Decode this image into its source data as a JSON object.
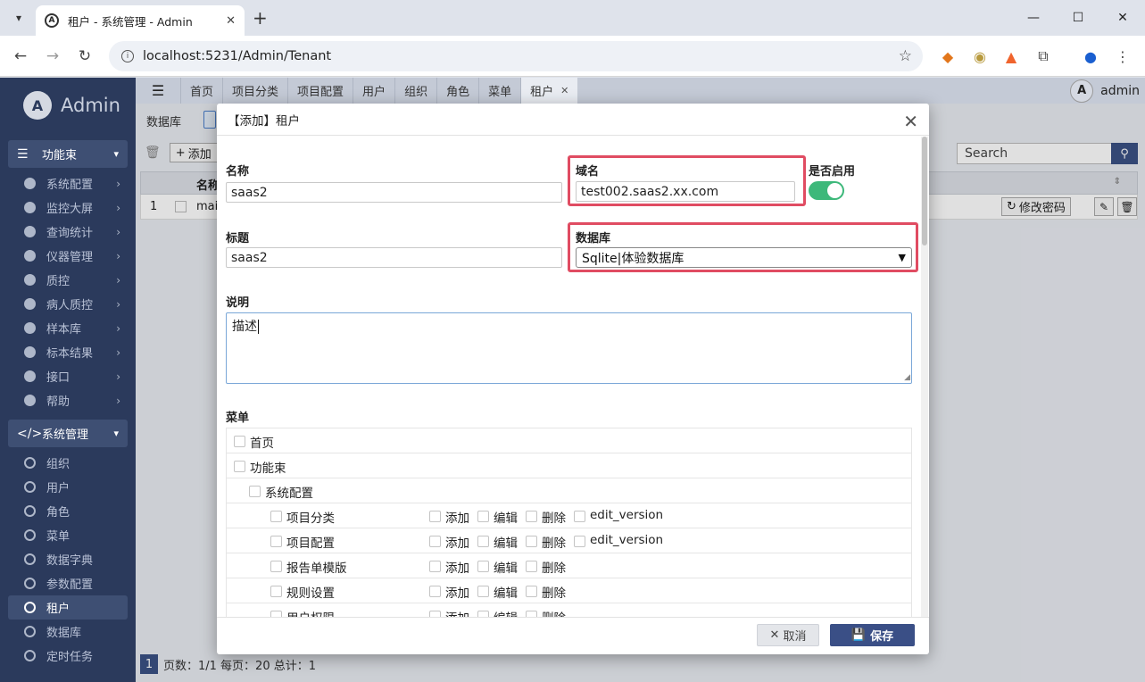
{
  "browser": {
    "tab_title": "租户 - 系统管理 - Admin",
    "favicon_letter": "A",
    "url": "localhost:5231/Admin/Tenant"
  },
  "sidebar": {
    "logo_letter": "A",
    "logo_text": "Admin",
    "group1": {
      "label": "功能束",
      "items": [
        "系统配置",
        "监控大屏",
        "查询统计",
        "仪器管理",
        "质控",
        "病人质控",
        "样本库",
        "标本结果",
        "接口",
        "帮助"
      ]
    },
    "group2": {
      "label": "系统管理",
      "items": [
        "组织",
        "用户",
        "角色",
        "菜单",
        "数据字典",
        "参数配置",
        "租户",
        "数据库",
        "定时任务"
      ],
      "active_index": 6
    }
  },
  "apptabs": {
    "tabs": [
      "首页",
      "项目分类",
      "项目配置",
      "用户",
      "组织",
      "角色",
      "菜单",
      "租户"
    ],
    "active_index": 7,
    "user_letter": "A",
    "user_name": "admin"
  },
  "background": {
    "db_label": "数据库",
    "add_label": "添加",
    "search_placeholder": "Search",
    "col_name": "名称",
    "row_num": "1",
    "row_name": "mai",
    "change_pwd": "修改密码",
    "pager_page": "1",
    "pager_text": "页数：1/1 每页：20 总计：1"
  },
  "dialog": {
    "title": "【添加】租户",
    "name_label": "名称",
    "name_value": "saas2",
    "domain_label": "域名",
    "domain_value": "test002.saas2.xx.com",
    "enabled_label": "是否启用",
    "enabled": true,
    "title_label": "标题",
    "title_value": "saas2",
    "db_label": "数据库",
    "db_value": "Sqlite|体验数据库",
    "desc_label": "说明",
    "desc_value": "描述",
    "menu_label": "菜单",
    "cancel_label": "取消",
    "save_label": "保存"
  },
  "menu_tree": [
    {
      "label": "首页",
      "level": 0,
      "actions": []
    },
    {
      "label": "功能束",
      "level": 0,
      "actions": []
    },
    {
      "label": "系统配置",
      "level": 1,
      "actions": []
    },
    {
      "label": "项目分类",
      "level": 2,
      "actions": [
        "添加",
        "编辑",
        "删除",
        "edit_version"
      ]
    },
    {
      "label": "项目配置",
      "level": 2,
      "actions": [
        "添加",
        "编辑",
        "删除",
        "edit_version"
      ]
    },
    {
      "label": "报告单模版",
      "level": 2,
      "actions": [
        "添加",
        "编辑",
        "删除"
      ]
    },
    {
      "label": "规则设置",
      "level": 2,
      "actions": [
        "添加",
        "编辑",
        "删除"
      ]
    },
    {
      "label": "用户权限",
      "level": 2,
      "actions": [
        "添加",
        "编辑",
        "删除"
      ]
    }
  ],
  "colors": {
    "sidebar_bg": "#2b3a5c",
    "accent": "#3a4f86",
    "highlight": "#e04c62",
    "toggle_on": "#3db87a"
  }
}
